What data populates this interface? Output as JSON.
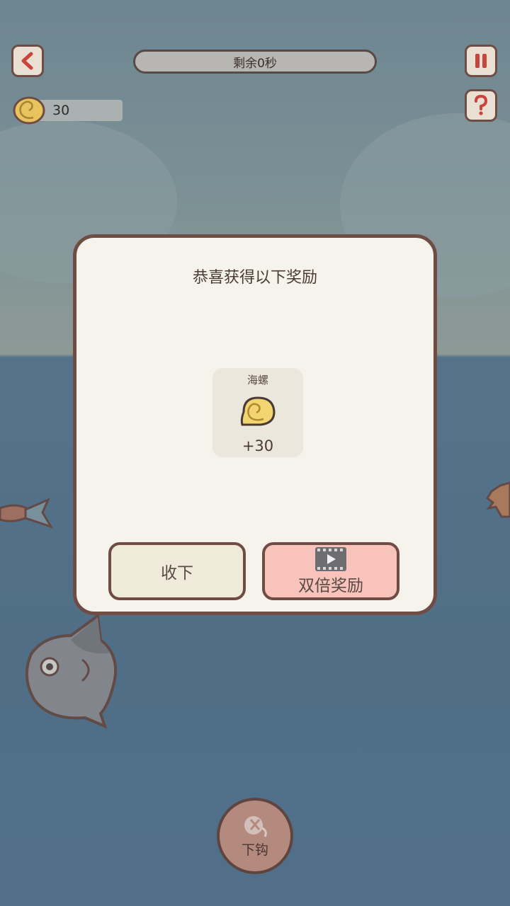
{
  "hud": {
    "timer_text": "剩余0秒",
    "coin_count": "30",
    "back_icon": "chevron-left-icon",
    "pause_icon": "pause-icon",
    "help_icon": "question-icon"
  },
  "dialog": {
    "title": "恭喜获得以下奖励",
    "reward": {
      "name": "海螺",
      "amount": "+30",
      "icon": "snail-shell-icon"
    },
    "accept_label": "收下",
    "double_label": "双倍奖励",
    "double_icon": "video-play-icon"
  },
  "hook_button": {
    "label": "下钩",
    "icon": "hook-icon"
  },
  "colors": {
    "border": "#6f4d45",
    "dialog_bg": "#f6f3ec",
    "accept_bg": "#f0eadb",
    "double_bg": "#f8c3bb",
    "water": "#5a7b94",
    "shell": "#f2d470"
  }
}
